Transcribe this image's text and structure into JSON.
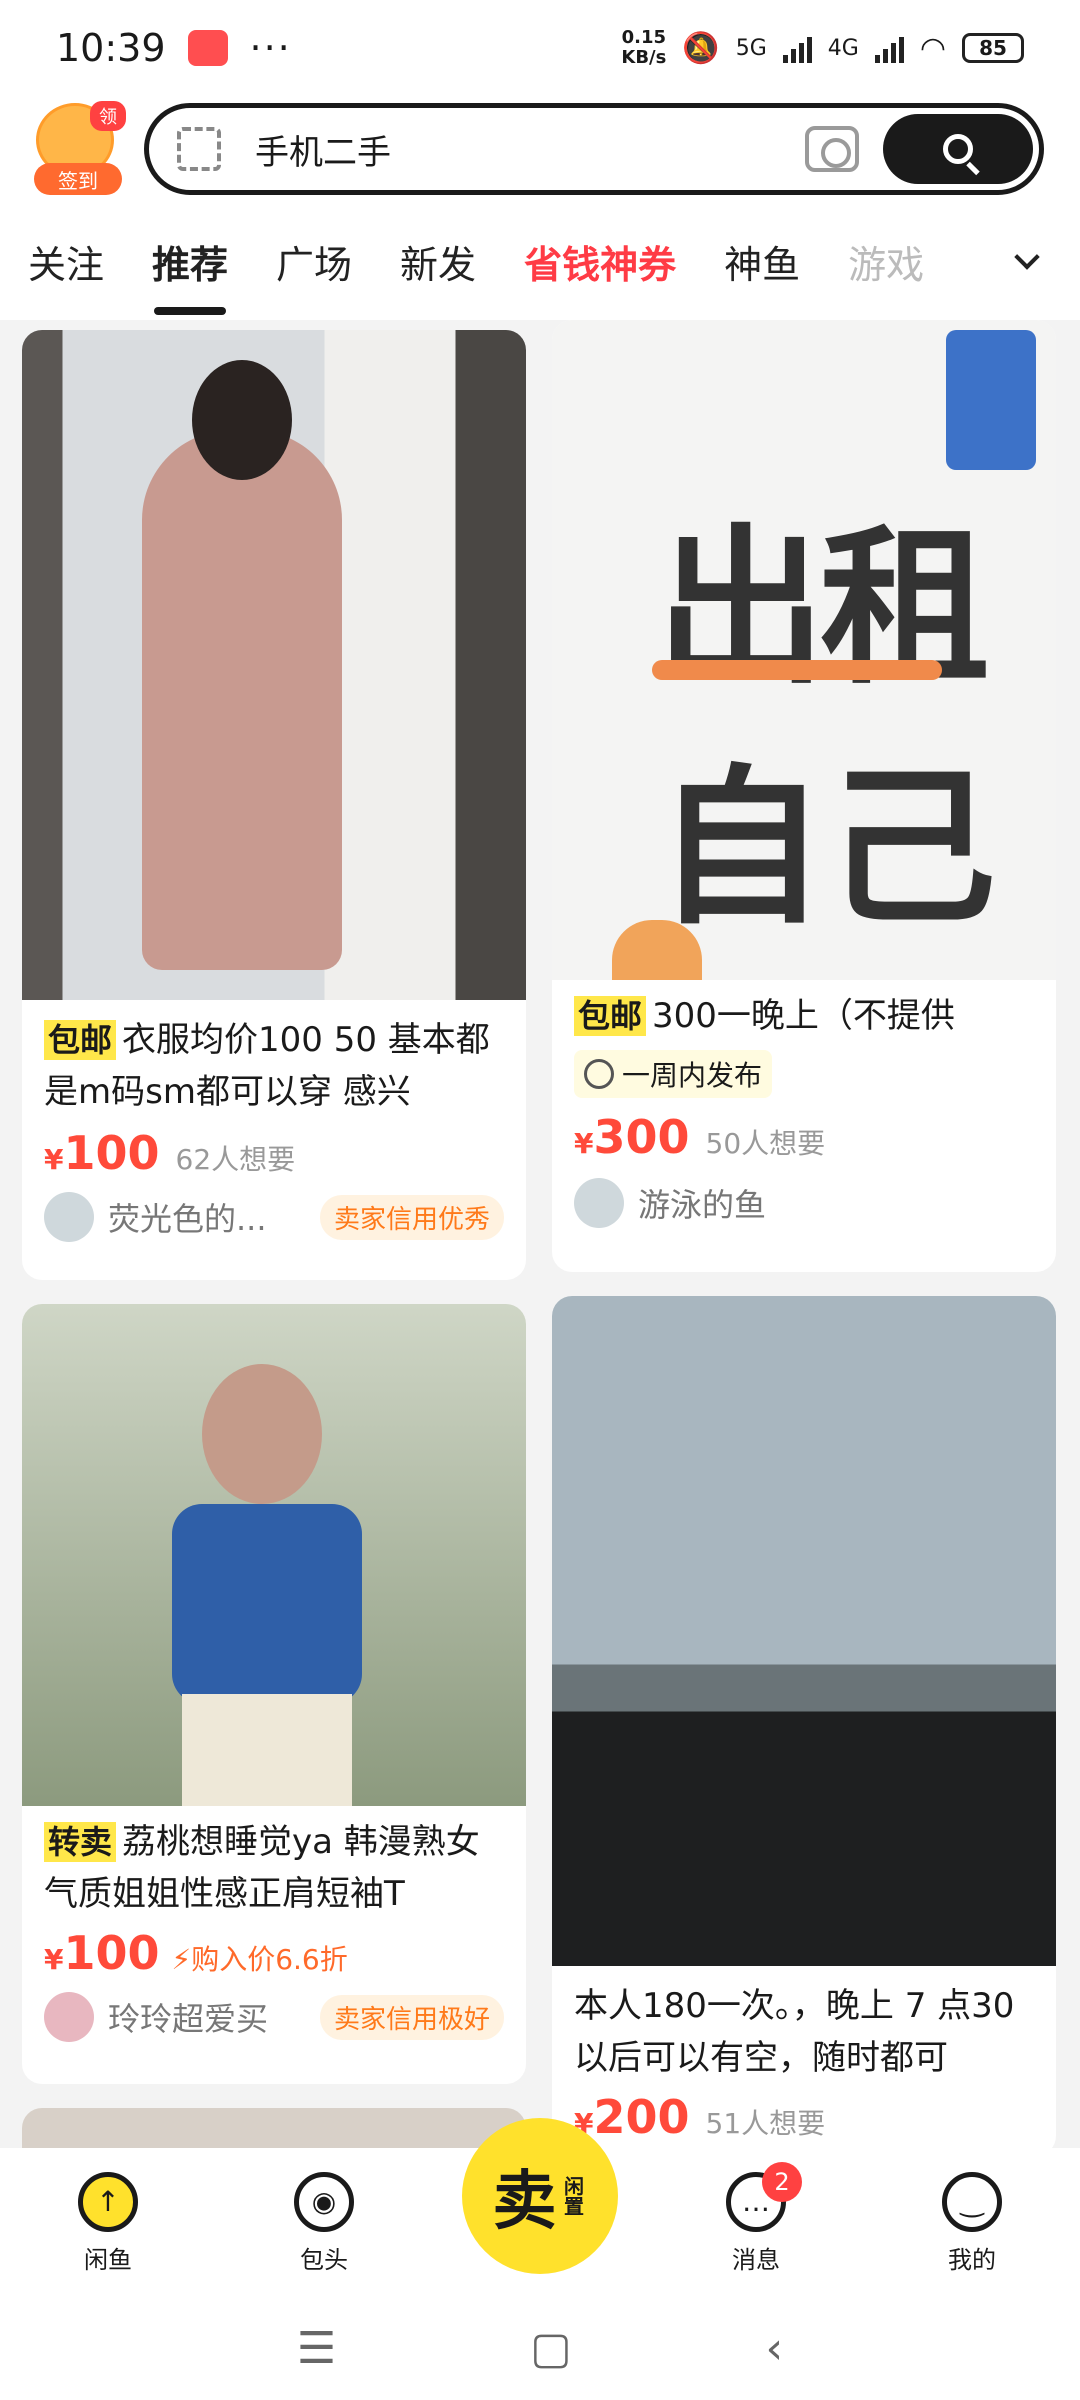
{
  "status": {
    "time": "10:39",
    "speed_top": "0.15",
    "speed_bottom": "KB/s",
    "net1": "5G",
    "net2": "4G",
    "battery": "85"
  },
  "header": {
    "signin_label": "签到",
    "ling": "领",
    "search_query": "手机二手"
  },
  "tabs": [
    "关注",
    "推荐",
    "广场",
    "新发",
    "省钱神券",
    "神鱼",
    "游戏"
  ],
  "cards": [
    {
      "tag": "包邮",
      "title": "衣服均价100 50  基本都是m码sm都可以穿 感兴",
      "price": "100",
      "want": "62人想要",
      "seller": "荧光色的...",
      "badge": "卖家信用优秀"
    },
    {
      "tag": "包邮",
      "title": "300一晚上（不提供",
      "time": "一周内发布",
      "price": "300",
      "want": "50人想要",
      "seller": "游泳的鱼",
      "image_text_1": "出租",
      "image_text_2": "自己"
    },
    {
      "tag": "转卖",
      "title": "荔桃想睡觉ya 韩漫熟女气质姐姐性感正肩短袖T",
      "price": "100",
      "extra": "购入价6.6折",
      "seller": "玲玲超爱买",
      "badge": "卖家信用极好"
    },
    {
      "title": "本人180一次。，晚上 7 点30以后可以有空，随时都可",
      "price": "200",
      "want": "51人想要"
    }
  ],
  "nav": {
    "home": "闲鱼",
    "baotou": "包头",
    "sell": "卖",
    "sell_sub": "闲置",
    "msg": "消息",
    "msg_count": "2",
    "me": "我的"
  },
  "currency": "¥"
}
